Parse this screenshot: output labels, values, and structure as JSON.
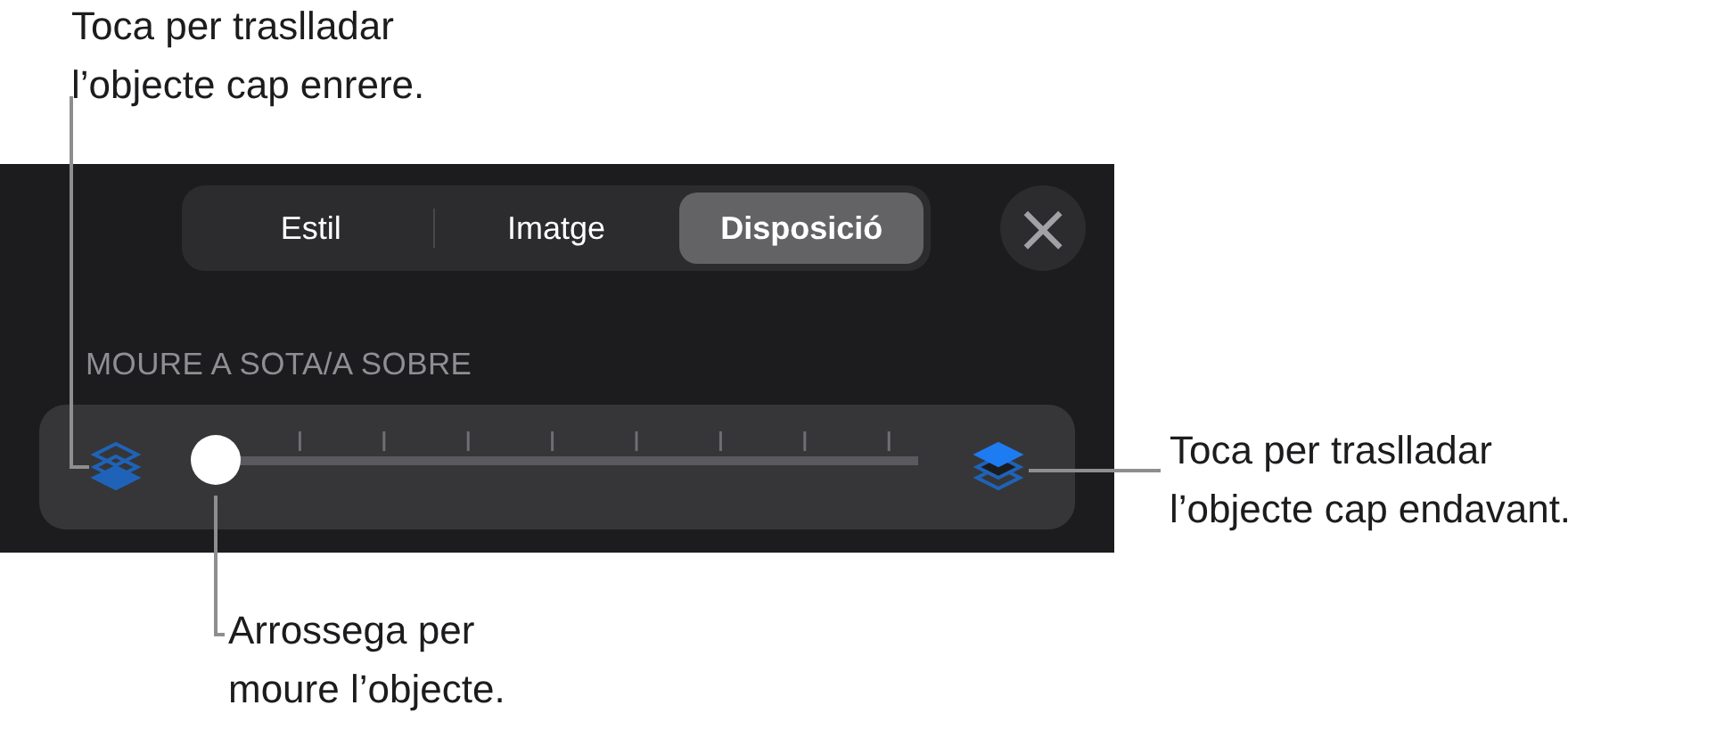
{
  "tabs": [
    {
      "label": "Estil",
      "selected": false
    },
    {
      "label": "Imatge",
      "selected": false
    },
    {
      "label": "Disposició",
      "selected": true
    }
  ],
  "close_button": {
    "label": "×"
  },
  "section_label": "MOURE A SOTA/A SOBRE",
  "slider": {
    "level": 0
  },
  "callouts": [
    {
      "kind": "back",
      "text": "Toca per traslladar\nl’objecte cap enrere."
    },
    {
      "kind": "front",
      "text": "Toca per traslladar\nl’objecte cap endavant."
    },
    {
      "kind": "thumb",
      "text": "Arrossega per\nmoure l’objecte."
    }
  ]
}
